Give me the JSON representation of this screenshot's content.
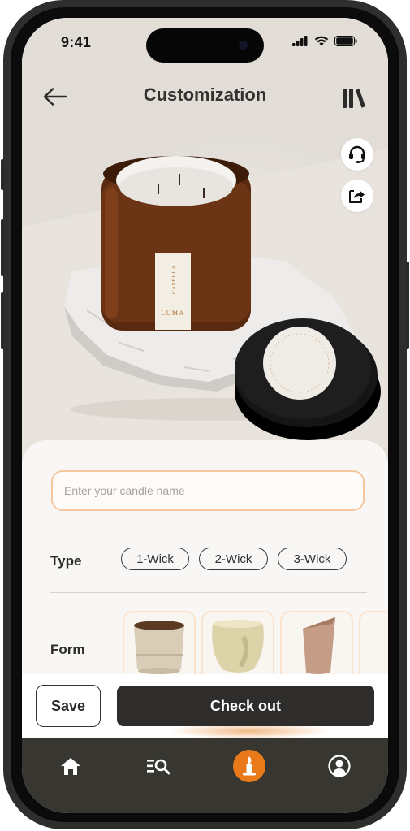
{
  "status_bar": {
    "time": "9:41"
  },
  "header": {
    "title": "Customization"
  },
  "hero": {
    "jar_label_brand": "LUMA",
    "jar_label_name": "CAPELLA",
    "lid_text": "HANDMADE IN THE UK · LUMA ·"
  },
  "form": {
    "name_placeholder": "Enter your candle name",
    "type_label": "Type",
    "type_options": [
      "1-Wick",
      "2-Wick",
      "3-Wick"
    ],
    "form_label": "Form"
  },
  "actions": {
    "save_label": "Save",
    "checkout_label": "Check out"
  },
  "tabs": [
    {
      "name": "home",
      "icon": "home-icon"
    },
    {
      "name": "search-list",
      "icon": "search-list-icon"
    },
    {
      "name": "customize",
      "icon": "candle-icon",
      "active": true
    },
    {
      "name": "profile",
      "icon": "profile-icon"
    }
  ],
  "colors": {
    "accent": "#ea7a19",
    "dark": "#2e2d2b",
    "input_border": "#f4c8a1",
    "tabbar": "#373631"
  }
}
